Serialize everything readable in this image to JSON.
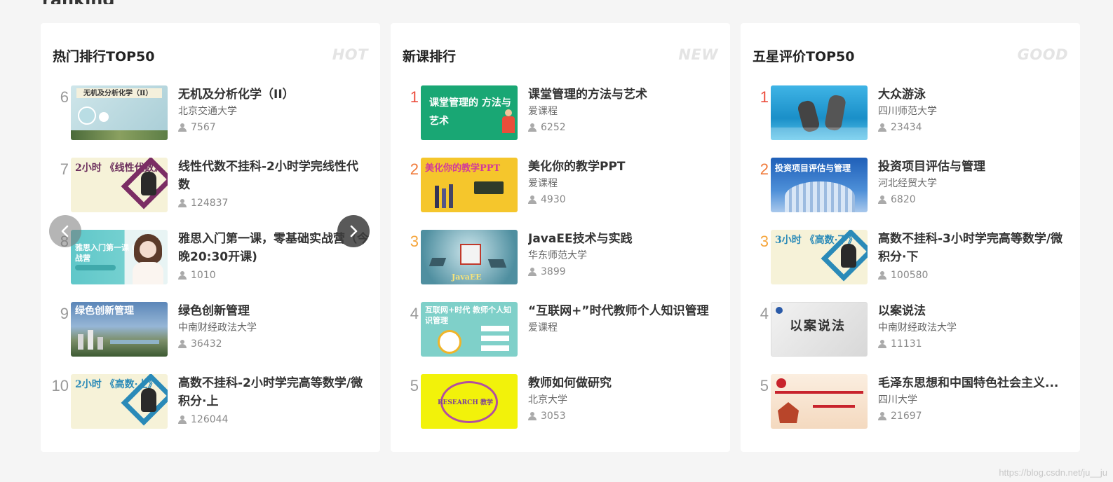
{
  "panels": [
    {
      "title": "热门排行TOP50",
      "tag": "HOT",
      "items": [
        {
          "rank": "6",
          "title": "无机及分析化学（II）",
          "school": "北京交通大学",
          "count": "7567",
          "thumb_text": "无机及分析化学（Ⅱ）"
        },
        {
          "rank": "7",
          "title": "线性代数不挂科-2小时学完线性代数",
          "school": "",
          "count": "124837",
          "thumb_text": "2小时 《线性代数》"
        },
        {
          "rank": "8",
          "title": "雅思入门第一课，零基础实战营（今晚20:30开课)",
          "school": "",
          "count": "1010",
          "thumb_text": "雅思入门第一课 0基础实战营"
        },
        {
          "rank": "9",
          "title": "绿色创新管理",
          "school": "中南财经政法大学",
          "count": "36432",
          "thumb_text": "绿色创新管理"
        },
        {
          "rank": "10",
          "title": "高数不挂科-2小时学完高等数学/微积分·上",
          "school": "",
          "count": "126044",
          "thumb_text": "2小时 《高数·上》"
        }
      ]
    },
    {
      "title": "新课排行",
      "tag": "NEW",
      "items": [
        {
          "rank": "1",
          "title": "课堂管理的方法与艺术",
          "school": "爱课程",
          "count": "6252",
          "thumb_text": "课堂管理的 方法与艺术"
        },
        {
          "rank": "2",
          "title": "美化你的教学PPT",
          "school": "爱课程",
          "count": "4930",
          "thumb_text": "美化你的教学PPT"
        },
        {
          "rank": "3",
          "title": "JavaEE技术与实践",
          "school": "华东师范大学",
          "count": "3899",
          "thumb_text": "JavaEE"
        },
        {
          "rank": "4",
          "title": "“互联网+”时代教师个人知识管理",
          "school": "爱课程",
          "count": "",
          "thumb_text": "互联网+时代 教师个人知识管理"
        },
        {
          "rank": "5",
          "title": "教师如何做研究",
          "school": "北京大学",
          "count": "3053",
          "thumb_text": "RESEARCH 教学"
        }
      ]
    },
    {
      "title": "五星评价TOP50",
      "tag": "GOOD",
      "items": [
        {
          "rank": "1",
          "title": "大众游泳",
          "school": "四川师范大学",
          "count": "23434",
          "thumb_text": ""
        },
        {
          "rank": "2",
          "title": "投资项目评估与管理",
          "school": "河北经贸大学",
          "count": "6820",
          "thumb_text": "投资项目评估与管理"
        },
        {
          "rank": "3",
          "title": "高数不挂科-3小时学完高等数学/微积分·下",
          "school": "",
          "count": "100580",
          "thumb_text": "3小时 《高数·下》"
        },
        {
          "rank": "4",
          "title": "以案说法",
          "school": "中南财经政法大学",
          "count": "11131",
          "thumb_text": "以案说法"
        },
        {
          "rank": "5",
          "title": "毛泽东思想和中国特色社会主义...",
          "school": "四川大学",
          "count": "21697",
          "thumb_text": ""
        }
      ]
    }
  ],
  "colors": {
    "rank1": "#ec4e3e",
    "rank2": "#f07a3a",
    "rank3": "#f5a43a",
    "rank_other": "#999999"
  },
  "watermark": "https://blog.csdn.net/ju__ju"
}
